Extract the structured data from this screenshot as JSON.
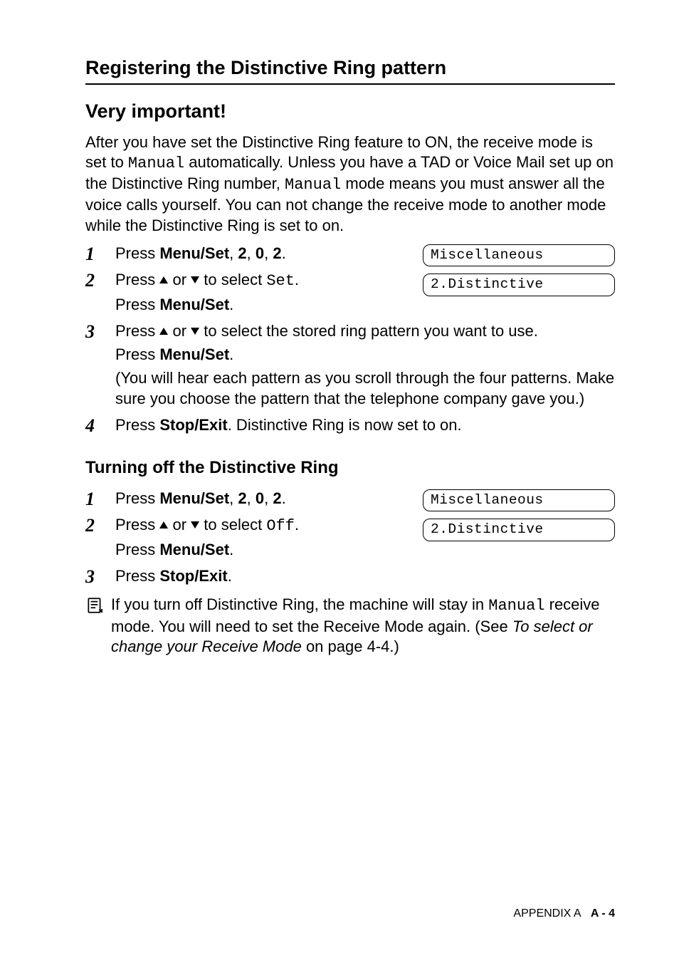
{
  "heading_main": "Registering the Distinctive Ring pattern",
  "heading_sub": "Very important!",
  "intro_parts": {
    "p1": "After you have set the Distinctive Ring feature to ON, the receive mode is set to ",
    "mono1": "Manual",
    "p2": " automatically. Unless you have a TAD or Voice Mail set up on the Distinctive Ring number, ",
    "mono2": "Manual",
    "p3": " mode means you must answer all the voice calls yourself. You can not change the receive mode to another mode while the Distinctive Ring is set to on."
  },
  "steps1": {
    "s1": {
      "pre": "Press ",
      "bold1": "Menu/Set",
      "mid1": ", ",
      "bold2": "2",
      "mid2": ", ",
      "bold3": "0",
      "mid3": ", ",
      "bold4": "2",
      "post": "."
    },
    "s2": {
      "pre": "Press ",
      "mid": " or ",
      "post1": " to select ",
      "mono": "Set",
      "post2": ".",
      "line2_pre": "Press ",
      "line2_bold": "Menu/Set",
      "line2_post": "."
    },
    "s3": {
      "pre": "Press ",
      "mid": " or ",
      "post": " to select the stored ring pattern you want to use.",
      "line2_pre": "Press ",
      "line2_bold": "Menu/Set",
      "line2_post": ".",
      "line3": "(You will hear each pattern as you scroll through the four patterns. Make sure you choose the pattern that the telephone company gave you.)"
    },
    "s4": {
      "pre": "Press ",
      "bold": "Stop/Exit",
      "post": ". Distinctive Ring is now set to on."
    }
  },
  "lcd1": {
    "a": "Miscellaneous",
    "b": "2.Distinctive"
  },
  "heading_turnoff": "Turning off the Distinctive Ring",
  "steps2": {
    "s1": {
      "pre": "Press ",
      "bold1": "Menu/Set",
      "mid1": ", ",
      "bold2": "2",
      "mid2": ", ",
      "bold3": "0",
      "mid3": ", ",
      "bold4": "2",
      "post": "."
    },
    "s2": {
      "pre": "Press ",
      "mid": " or ",
      "post1": " to select ",
      "mono": "Off",
      "post2": ".",
      "line2_pre": "Press ",
      "line2_bold": "Menu/Set",
      "line2_post": "."
    },
    "s3": {
      "pre": "Press ",
      "bold": "Stop/Exit",
      "post": "."
    }
  },
  "lcd2": {
    "a": "Miscellaneous",
    "b": "2.Distinctive"
  },
  "note": {
    "p1": "If you turn off Distinctive Ring, the machine will stay in ",
    "mono": "Manual",
    "p2": " receive mode. You will need to set the Receive Mode again. (See ",
    "italic": "To select or change your Receive Mode",
    "p3": " on page 4-4.)"
  },
  "footer": {
    "label": "APPENDIX A",
    "page": "A - 4"
  }
}
